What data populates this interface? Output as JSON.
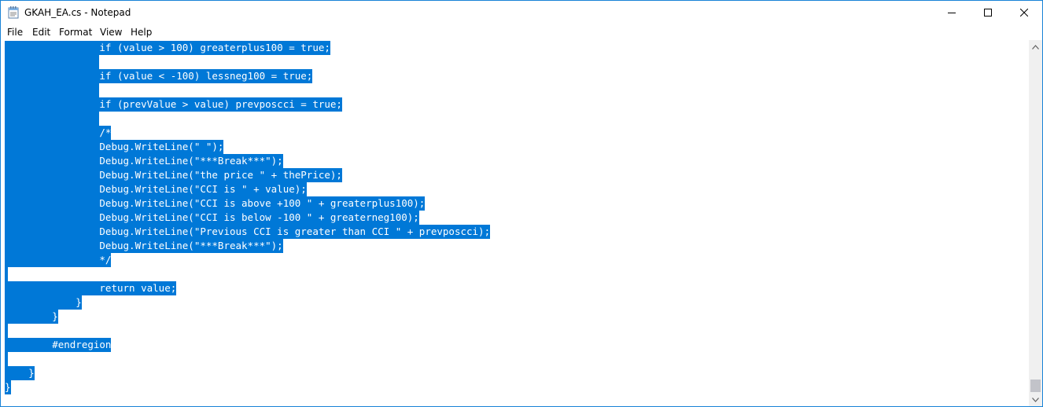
{
  "window": {
    "title": "GKAH_EA.cs - Notepad"
  },
  "menu": {
    "file": "File",
    "edit": "Edit",
    "format": "Format",
    "view": "View",
    "help": "Help"
  },
  "editor": {
    "lines": [
      "                if (value > 100) greaterplus100 = true;",
      "                ",
      "                if (value < -100) lessneg100 = true;",
      "                ",
      "                if (prevValue > value) prevposcci = true;",
      "                ",
      "                /*",
      "                Debug.WriteLine(\" \");",
      "                Debug.WriteLine(\"***Break***\");",
      "                Debug.WriteLine(\"the price \" + thePrice);",
      "                Debug.WriteLine(\"CCI is \" + value);",
      "                Debug.WriteLine(\"CCI is above +100 \" + greaterplus100);",
      "                Debug.WriteLine(\"CCI is below -100 \" + greaterneg100);",
      "                Debug.WriteLine(\"Previous CCI is greater than CCI \" + prevposcci);",
      "                Debug.WriteLine(\"***Break***\");",
      "                */",
      "",
      "                return value;",
      "            }",
      "        }",
      "",
      "        #endregion",
      "",
      "    }",
      "}"
    ]
  },
  "colors": {
    "selection": "#0078d7",
    "selection_text": "#ffffff",
    "window_border": "#1883d7"
  }
}
